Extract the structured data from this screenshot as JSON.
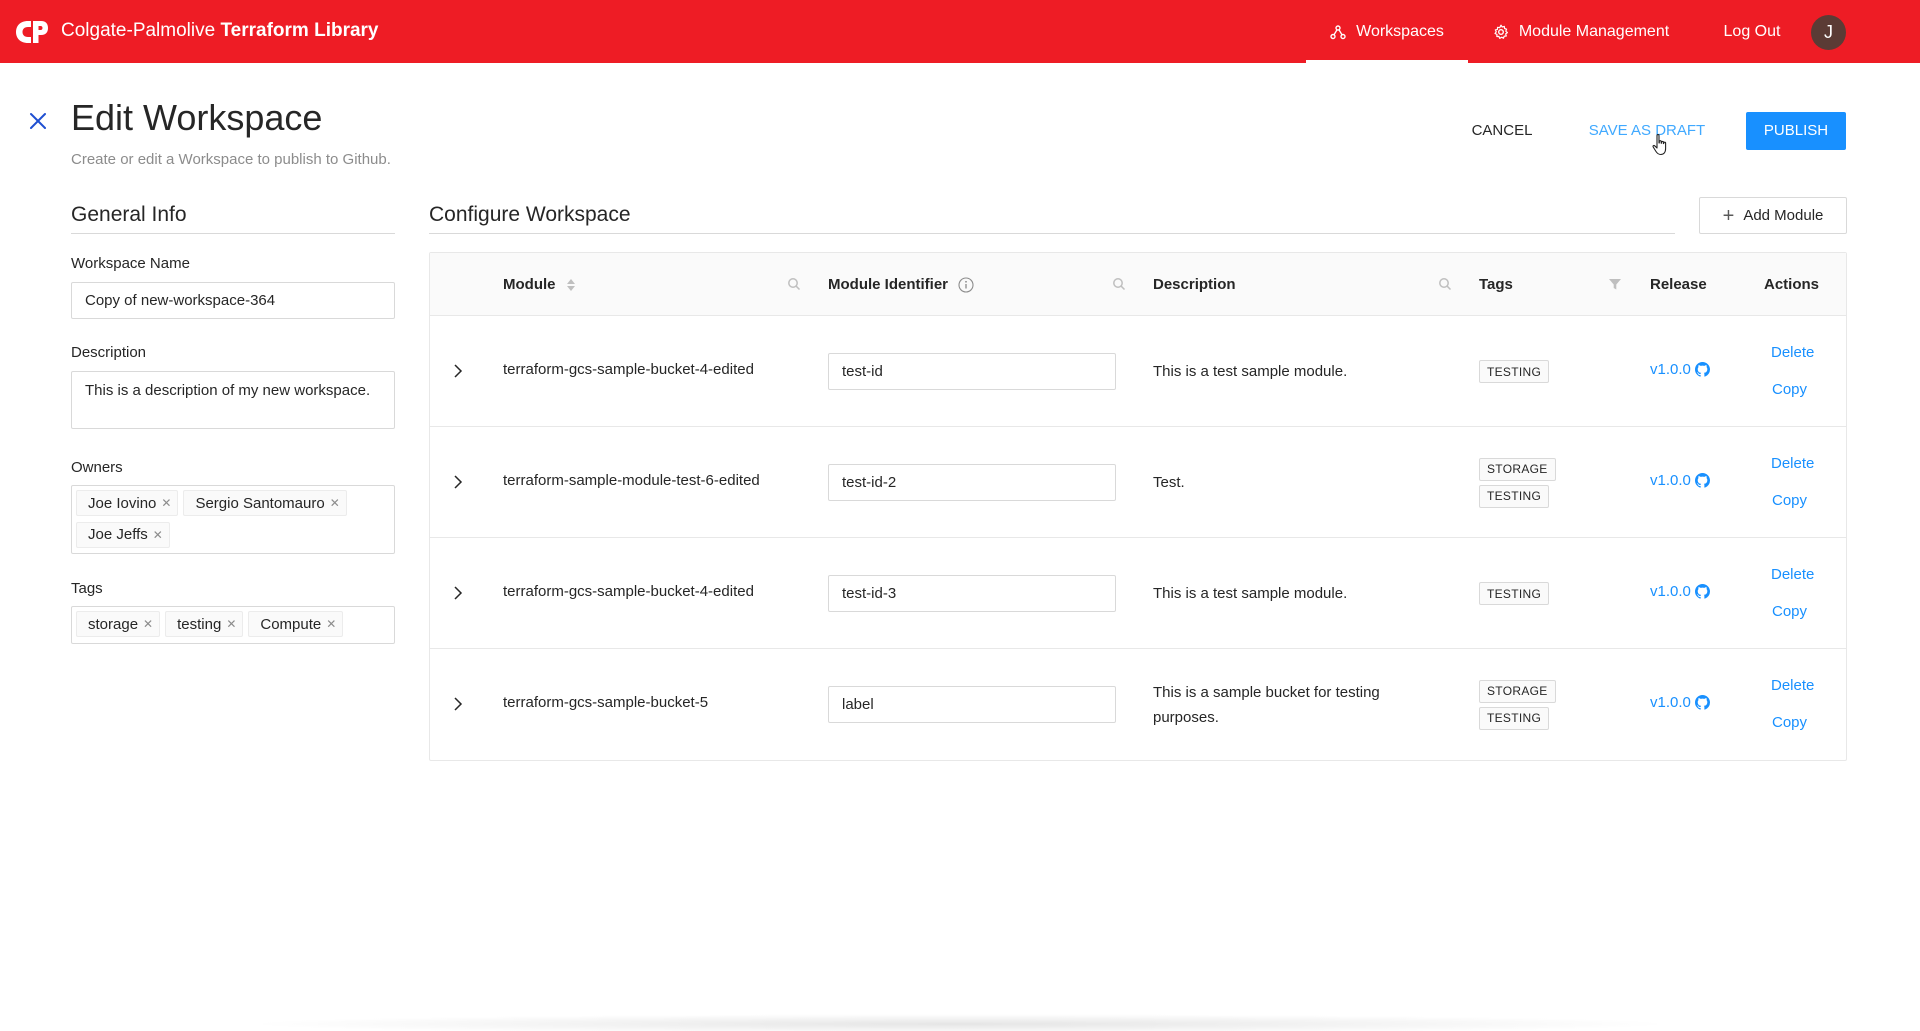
{
  "header": {
    "brand_prefix": "Colgate-Palmolive",
    "brand_name": "Terraform Library",
    "nav": {
      "workspaces": "Workspaces",
      "module_management": "Module Management",
      "logout": "Log Out"
    },
    "avatar_initial": "J",
    "bg_color": "#ee1c25"
  },
  "page": {
    "title": "Edit Workspace",
    "subtitle": "Create or edit a Workspace to publish to Github.",
    "actions": {
      "cancel": "CANCEL",
      "save_draft": "SAVE AS DRAFT",
      "publish": "PUBLISH"
    }
  },
  "general_info": {
    "title": "General Info",
    "workspace_name_label": "Workspace Name",
    "workspace_name_value": "Copy of new-workspace-364",
    "description_label": "Description",
    "description_value": "This is a description of my new workspace.",
    "owners_label": "Owners",
    "owners": [
      "Joe Iovino",
      "Sergio Santomauro",
      "Joe Jeffs"
    ],
    "tags_label": "Tags",
    "tags": [
      "storage",
      "testing",
      "Compute"
    ]
  },
  "configure": {
    "title": "Configure Workspace",
    "add_module": "Add Module",
    "columns": {
      "module": "Module",
      "identifier": "Module Identifier",
      "description": "Description",
      "tags": "Tags",
      "release": "Release",
      "actions": "Actions"
    },
    "action_labels": {
      "delete": "Delete",
      "copy": "Copy"
    },
    "rows": [
      {
        "module": "terraform-gcs-sample-bucket-4-edited",
        "identifier": "test-id",
        "description": "This is a test sample module.",
        "tags": [
          "TESTING"
        ],
        "release": "v1.0.0"
      },
      {
        "module": "terraform-sample-module-test-6-edited",
        "identifier": "test-id-2",
        "description": "Test.",
        "tags": [
          "STORAGE",
          "TESTING"
        ],
        "release": "v1.0.0"
      },
      {
        "module": "terraform-gcs-sample-bucket-4-edited",
        "identifier": "test-id-3",
        "description": "This is a test sample module.",
        "tags": [
          "TESTING"
        ],
        "release": "v1.0.0"
      },
      {
        "module": "terraform-gcs-sample-bucket-5",
        "identifier": "label",
        "description": "This is a sample bucket for testing purposes.",
        "tags": [
          "STORAGE",
          "TESTING"
        ],
        "release": "v1.0.0"
      }
    ]
  },
  "colors": {
    "brand_red": "#ee1c25",
    "primary_blue": "#1890ff",
    "link_blue": "#40a9ff"
  },
  "icons": {
    "logo": "colgate-cp-logo",
    "workspaces": "workspaces-icon",
    "module_management": "gear-icon",
    "close": "close-icon",
    "search": "search-icon",
    "sort": "sort-icon",
    "info": "info-icon",
    "filter": "filter-icon",
    "expand": "chevron-right-icon",
    "github": "github-icon",
    "add": "plus-icon"
  }
}
